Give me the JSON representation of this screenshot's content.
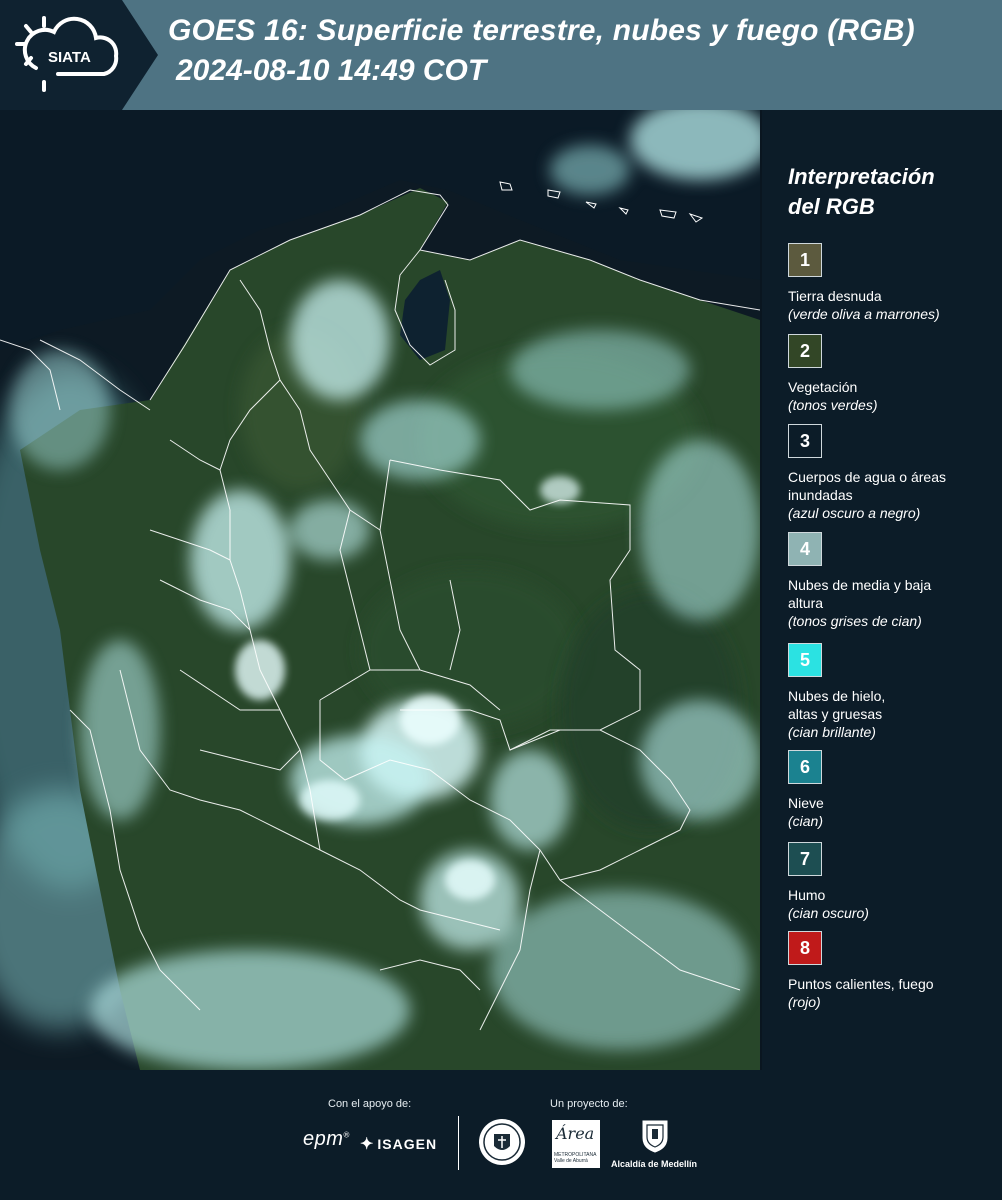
{
  "header": {
    "logo_text": "SIATA",
    "title": "GOES 16: Superficie terrestre, nubes y fuego (RGB)",
    "subtitle": "2024-08-10 14:49 COT"
  },
  "legend": {
    "title_line1": "Interpretación",
    "title_line2": "del RGB",
    "items": [
      {
        "num": "1",
        "label": "Tierra desnuda",
        "sub": "(verde oliva a marrones)",
        "color": "#5c5a3e"
      },
      {
        "num": "2",
        "label": "Vegetación",
        "sub": "(tonos verdes)",
        "color": "#324626"
      },
      {
        "num": "3",
        "label": "Cuerpos de agua o áreas inundadas",
        "sub": "(azul oscuro a negro)",
        "color": "#0c1c28"
      },
      {
        "num": "4",
        "label": "Nubes de media y baja altura",
        "sub": "(tonos grises de cian)",
        "color": "#8fb3b3"
      },
      {
        "num": "5",
        "label": "Nubes de hielo, altas y gruesas",
        "sub": "(cian brillante)",
        "color": "#2be2e2"
      },
      {
        "num": "6",
        "label": "Nieve",
        "sub": "(cian)",
        "color": "#1b8290"
      },
      {
        "num": "7",
        "label": "Humo",
        "sub": "(cian oscuro)",
        "color": "#1d4e52"
      },
      {
        "num": "8",
        "label": "Puntos calientes, fuego",
        "sub": "(rojo)",
        "color": "#c01a1a"
      }
    ]
  },
  "footer": {
    "support_label": "Con el apoyo de:",
    "project_label": "Un proyecto de:",
    "epm": "epm",
    "isagen": "ISAGEN",
    "area_logo": "Área",
    "area_logo_sub": "METROPOLITANA Valle de Aburrá",
    "medellin": "Alcaldía de Medellín"
  },
  "colors": {
    "header_band": "#4e7383",
    "background": "#0c1c28",
    "vegetation": "#2a4a2a",
    "cloud": "#9fe6e6",
    "border_lines": "#ffffff"
  }
}
